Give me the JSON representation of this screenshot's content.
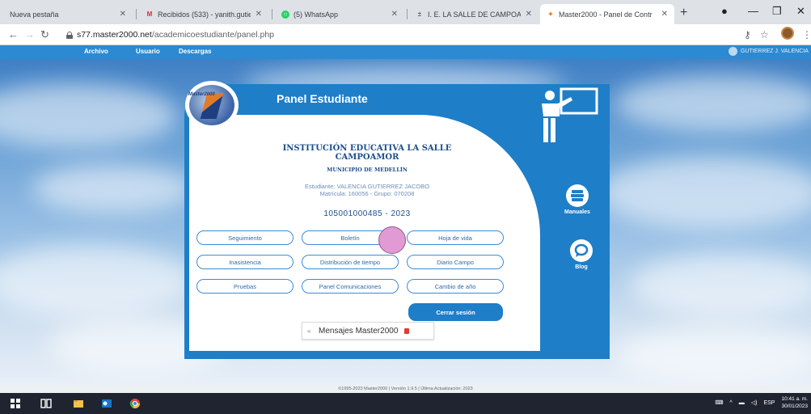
{
  "browser": {
    "tabs": [
      {
        "title": "Nueva pestaña",
        "favicon": "blank"
      },
      {
        "title": "Recibidos (533) - yanith.gutie",
        "favicon": "gmail-icon"
      },
      {
        "title": "(5) WhatsApp",
        "favicon": "whatsapp-icon"
      },
      {
        "title": "I. E. LA SALLE DE CAMPOAMO",
        "favicon": "school-icon"
      },
      {
        "title": "Master2000 - Panel de Contr",
        "favicon": "master-icon"
      }
    ],
    "url_domain": "s77.master2000.net",
    "url_path": "/academicoestudiante/panel.php"
  },
  "site_nav": {
    "items": [
      "Archivo",
      "Usuario",
      "Descargas"
    ],
    "user": "GUTIERREZ J. VALENCIA"
  },
  "panel": {
    "title": "Panel Estudiante",
    "logo_text": "Master2000",
    "institution": "INSTITUCIÓN EDUCATIVA LA SALLE CAMPOAMOR",
    "municipality": "MUNICIPIO DE MEDELLÍN",
    "student_line": "Estudiante: VALENCIA GUTIERREZ JACOBO",
    "enrollment_line": "Matrícula: 160056 - Grupo: 070208",
    "code": "105001000485 - 2023",
    "buttons": [
      "Seguimiento",
      "Boletín",
      "Hoja de vida",
      "Inasistencia",
      "Distribución de tiempo",
      "Diario Campo",
      "Pruebas",
      "Panel Comunicaciones",
      "Cambio de año"
    ],
    "logout": "Cerrar sesión",
    "messages": "Mensajes Master2000",
    "side_manuals": "Manuales",
    "side_blog": "Blog"
  },
  "footer": "©1995-2023 Master2000 | Versión 1.9.5 | Última Actualización: 2023",
  "taskbar": {
    "language": "ESP",
    "time": "10:41 a. m.",
    "date": "30/01/2023"
  },
  "colors": {
    "brand_blue": "#1e7ec8",
    "nav_blue": "#2b8ad1",
    "text_navy": "#1c4e8c"
  }
}
